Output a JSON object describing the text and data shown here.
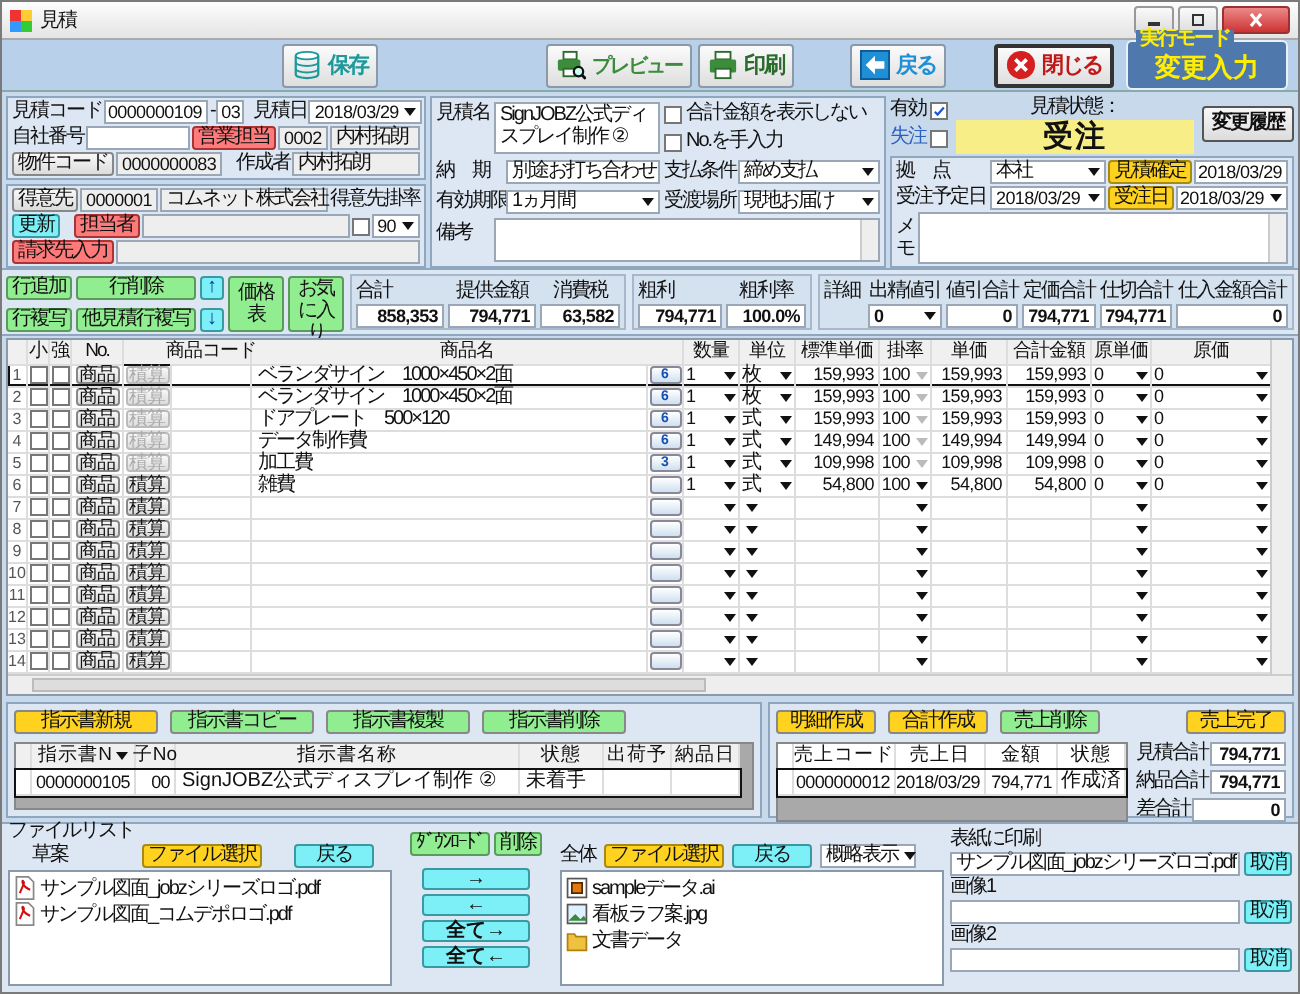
{
  "window": {
    "title": "見積"
  },
  "toolbar": [
    {
      "label": "保存",
      "kind": "save"
    },
    {
      "label": "プレビュー",
      "kind": "preview"
    },
    {
      "label": "印刷",
      "kind": "print"
    },
    {
      "label": "戻る",
      "kind": "back"
    },
    {
      "label": "閉じる",
      "kind": "close"
    }
  ],
  "mode": {
    "legend": "実行モード",
    "value": "変更入力"
  },
  "header": {
    "code_label": "見積コード",
    "code": "0000000109",
    "separator": "-",
    "branch": "03",
    "date_label": "見積日",
    "date": "2018/03/29",
    "company_no_label": "自社番号",
    "sales_button": "営業担当",
    "sales_code": "0002",
    "sales_name": "内村拓朗",
    "property_button": "物件コード",
    "property_code": "0000000083",
    "author_label": "作成者",
    "author": "内村拓朗"
  },
  "customer": {
    "button": "得意先",
    "code": "0000001",
    "name": "コムネット株式会社",
    "rate_label": "得意先掛率",
    "update_button": "更新",
    "contact_button": "担当者",
    "rate_checked": false,
    "rate": "90",
    "billing_button": "請求先入力"
  },
  "details": {
    "name_label": "見積名",
    "name": "SignJOBZ公式ディスプレイ制作 ②",
    "hide_total": {
      "label": "合計金額を表示しない",
      "checked": false
    },
    "manual_no": {
      "label": "No.を手入力",
      "checked": false
    },
    "delivery_label": "納　期",
    "delivery": "別途お打ち合わせ",
    "payment_label": "支払条件",
    "payment": "締め支払",
    "validity_label": "有効期限",
    "validity": "1ヵ月間",
    "place_label": "受渡場所",
    "place": "現地お届け",
    "remarks_label": "備考"
  },
  "status": {
    "valid": {
      "label": "有効",
      "checked": true
    },
    "lost": {
      "label": "失注",
      "checked": false
    },
    "state_label": "見積状態：",
    "state": "受注",
    "history_button": "変更履歴",
    "branch_label": "拠　点",
    "branch": "本社",
    "confirm_button": "見積確定",
    "confirm_date": "2018/03/29",
    "planned_label": "受注予定日",
    "planned_date": "2018/03/29",
    "order_button": "受注日",
    "order_date": "2018/03/29",
    "memo_label": "メモ"
  },
  "row_actions": {
    "add": "行追加",
    "delete": "行削除",
    "up": "↑",
    "copy": "行複写",
    "copy_other": "他見積行複写",
    "down": "↓",
    "price_list": "価格表",
    "favorites": "お気に入り"
  },
  "totals": {
    "title": "合計",
    "provided_label": "提供金額",
    "tax_label": "消費税",
    "total": "858,353",
    "provided": "794,771",
    "tax": "63,582"
  },
  "profit": {
    "title": "粗利",
    "rate_label": "粗利率",
    "amount": "794,771",
    "rate": "100.0%"
  },
  "detail": {
    "title": "詳細",
    "items": [
      {
        "label": "出精値引",
        "value": "0",
        "kind": "select"
      },
      {
        "label": "値引合計",
        "value": "0",
        "kind": "text"
      },
      {
        "label": "定価合計",
        "value": "794,771",
        "kind": "text"
      },
      {
        "label": "仕切合計",
        "value": "794,771",
        "kind": "text"
      },
      {
        "label": "仕入金額合計",
        "value": "0",
        "kind": "text"
      }
    ]
  },
  "table": {
    "columns": [
      "小",
      "強",
      "No.",
      "商品コード",
      "商品名",
      "数量",
      "単位",
      "標準単価",
      "掛率",
      "単価",
      "合計金額",
      "原単価",
      "原価"
    ],
    "rows": [
      {
        "no": "1",
        "small": false,
        "strong": false,
        "product_button": "商品",
        "estimate_button": "積算",
        "estimate_enabled": false,
        "name": "ベランダサイン　1000×450×2面",
        "calc": "6",
        "qty": "1",
        "unit": "枚",
        "std_price": "159,993",
        "rate": "100",
        "price": "159,993",
        "total": "159,993",
        "cost_price": "0",
        "cost": "0",
        "selected": true
      },
      {
        "no": "2",
        "small": false,
        "strong": false,
        "product_button": "商品",
        "estimate_button": "積算",
        "estimate_enabled": false,
        "name": "ベランダサイン　1000×450×2面",
        "calc": "6",
        "qty": "1",
        "unit": "枚",
        "std_price": "159,993",
        "rate": "100",
        "price": "159,993",
        "total": "159,993",
        "cost_price": "0",
        "cost": "0",
        "selected": false
      },
      {
        "no": "3",
        "small": false,
        "strong": false,
        "product_button": "商品",
        "estimate_button": "積算",
        "estimate_enabled": false,
        "name": "ドアプレート　500×120",
        "calc": "6",
        "qty": "1",
        "unit": "式",
        "std_price": "159,993",
        "rate": "100",
        "price": "159,993",
        "total": "159,993",
        "cost_price": "0",
        "cost": "0",
        "selected": false
      },
      {
        "no": "4",
        "small": false,
        "strong": false,
        "product_button": "商品",
        "estimate_button": "積算",
        "estimate_enabled": false,
        "name": "データ制作費",
        "calc": "6",
        "qty": "1",
        "unit": "式",
        "std_price": "149,994",
        "rate": "100",
        "price": "149,994",
        "total": "149,994",
        "cost_price": "0",
        "cost": "0",
        "selected": false
      },
      {
        "no": "5",
        "small": false,
        "strong": false,
        "product_button": "商品",
        "estimate_button": "積算",
        "estimate_enabled": false,
        "name": "加工費",
        "calc": "3",
        "qty": "1",
        "unit": "式",
        "std_price": "109,998",
        "rate": "100",
        "price": "109,998",
        "total": "109,998",
        "cost_price": "0",
        "cost": "0",
        "selected": false
      },
      {
        "no": "6",
        "small": false,
        "strong": false,
        "product_button": "商品",
        "estimate_button": "積算",
        "estimate_enabled": true,
        "name": "雑費",
        "qty": "1",
        "unit": "式",
        "std_price": "54,800",
        "rate": "100",
        "price": "54,800",
        "total": "54,800",
        "cost_price": "0",
        "cost": "0",
        "selected": false
      },
      {
        "no": "7",
        "small": false,
        "strong": false,
        "product_button": "商品",
        "estimate_button": "積算",
        "estimate_enabled": true,
        "selected": false
      },
      {
        "no": "8",
        "small": false,
        "strong": false,
        "product_button": "商品",
        "estimate_button": "積算",
        "estimate_enabled": true,
        "selected": false
      },
      {
        "no": "9",
        "small": false,
        "strong": false,
        "product_button": "商品",
        "estimate_button": "積算",
        "estimate_enabled": true,
        "selected": false
      },
      {
        "no": "10",
        "small": false,
        "strong": false,
        "product_button": "商品",
        "estimate_button": "積算",
        "estimate_enabled": true,
        "selected": false
      },
      {
        "no": "11",
        "small": false,
        "strong": false,
        "product_button": "商品",
        "estimate_button": "積算",
        "estimate_enabled": true,
        "selected": false
      },
      {
        "no": "12",
        "small": false,
        "strong": false,
        "product_button": "商品",
        "estimate_button": "積算",
        "estimate_enabled": true,
        "selected": false
      },
      {
        "no": "13",
        "small": false,
        "strong": false,
        "product_button": "商品",
        "estimate_button": "積算",
        "estimate_enabled": true,
        "selected": false
      },
      {
        "no": "14",
        "small": false,
        "strong": false,
        "product_button": "商品",
        "estimate_button": "積算",
        "estimate_enabled": true,
        "selected": false
      }
    ]
  },
  "instructions": {
    "buttons": [
      {
        "label": "指示書新規",
        "color": "#ffd21f"
      },
      {
        "label": "指示書コピー",
        "color": "#90ee90"
      },
      {
        "label": "指示書複製",
        "color": "#90ee90"
      },
      {
        "label": "指示書削除",
        "color": "#90ee90"
      }
    ],
    "columns": [
      "指示書N",
      "子No",
      "指示書名称",
      "状態",
      "出荷予",
      "納品日"
    ],
    "rows": [
      {
        "no": "0000000105",
        "child": "00",
        "name": "SignJOBZ公式ディスプレイ制作 ②",
        "status": "未着手"
      }
    ]
  },
  "sales": {
    "buttons": [
      {
        "label": "明細作成",
        "color": "#ffd21f"
      },
      {
        "label": "合計作成",
        "color": "#ffd21f"
      },
      {
        "label": "売上削除",
        "color": "#90ee90"
      }
    ],
    "complete_button": "売上完了",
    "columns": [
      "売上コード",
      "売上日",
      "金額",
      "状態"
    ],
    "rows": [
      {
        "code": "0000000012",
        "date": "2018/03/29",
        "amount": "794,771",
        "status": "作成済"
      }
    ],
    "summary": [
      {
        "label": "見積合計",
        "value": "794,771"
      },
      {
        "label": "納品合計",
        "value": "794,771"
      },
      {
        "label": "差合計",
        "value": "0"
      }
    ]
  },
  "files": {
    "title": "ファイルリスト",
    "draft_label": "草案",
    "select_button": "ファイル選択",
    "back_button": "戻る",
    "draft_files": [
      {
        "name": "サンプル図面_jobzシリーズロゴ.pdf",
        "kind": "pdf"
      },
      {
        "name": "サンプル図面_コムデポロゴ.pdf",
        "kind": "pdf"
      }
    ],
    "download_button": "ﾀﾞｳﾝﾛｰﾄﾞ",
    "delete_button": "削除",
    "transfer_buttons": [
      "→",
      "←",
      "全て→",
      "全て←"
    ],
    "all_label": "全体",
    "all_select_button": "ファイル選択",
    "all_back_button": "戻る",
    "view": "概略表示",
    "all_files": [
      {
        "name": "sampleデータ.ai",
        "kind": "ai"
      },
      {
        "name": "看板ラフ案.jpg",
        "kind": "jpg"
      },
      {
        "name": "文書データ",
        "kind": "folder"
      }
    ],
    "print_slots": [
      {
        "label": "表紙に印刷",
        "value": "サンプル図面_jobzシリーズロゴ.pdf",
        "button": "取消"
      },
      {
        "label": "画像1",
        "button": "取消"
      },
      {
        "label": "画像2",
        "button": "取消"
      }
    ]
  }
}
